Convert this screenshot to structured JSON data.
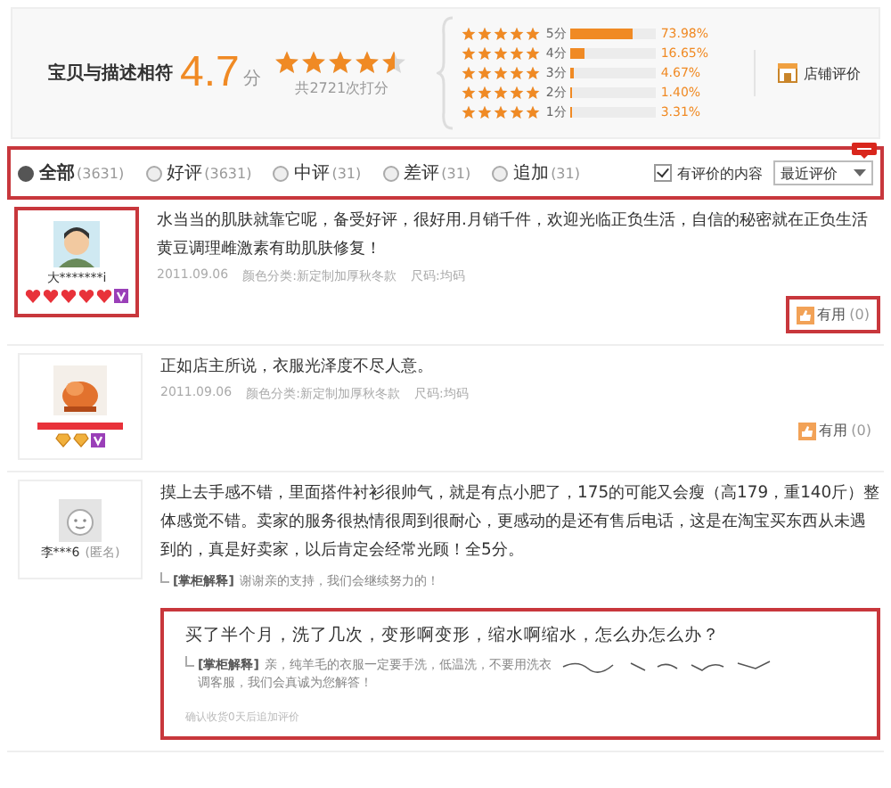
{
  "summary": {
    "label": "宝贝与描述相符",
    "score": "4.7",
    "unit": "分",
    "stars": 4.5,
    "count": "共2721次打分",
    "distribution": [
      {
        "stars": 5,
        "label": "5分",
        "level": 0.7398,
        "percent": "73.98%"
      },
      {
        "stars": 5,
        "label": "4分",
        "level": 0.1665,
        "percent": "16.65%"
      },
      {
        "stars": 5,
        "label": "3分",
        "level": 0.0467,
        "percent": "4.67%"
      },
      {
        "stars": 5,
        "label": "2分",
        "level": 0.014,
        "percent": "1.40%"
      },
      {
        "stars": 5,
        "label": "1分",
        "level": 0.0331,
        "percent": "3.31%"
      }
    ],
    "store_link": "店铺评价"
  },
  "filter": {
    "highlighted": true,
    "options": [
      {
        "label": "全部",
        "count": "(3631)",
        "selected": true
      },
      {
        "label": "好评",
        "count": "(3631)",
        "selected": false
      },
      {
        "label": "中评",
        "count": "(31)",
        "selected": false
      },
      {
        "label": "差评",
        "count": "(31)",
        "selected": false
      },
      {
        "label": "追加",
        "count": "(31)",
        "selected": false
      }
    ],
    "content_only": {
      "label": "有评价的内容",
      "checked": true
    },
    "sort": {
      "value": "最近评价"
    }
  },
  "reviews": [
    {
      "avatar": {
        "kind": "cartoon"
      },
      "highlighted": true,
      "name": "大*******i",
      "badges": [
        {
          "kind": "heart"
        },
        {
          "kind": "heart"
        },
        {
          "kind": "heart"
        },
        {
          "kind": "heart"
        },
        {
          "kind": "heart"
        },
        {
          "kind": "vip"
        }
      ],
      "text": "水当当的肌肤就靠它呢，备受好评，很好用.月销千件，欢迎光临正负生活，自信的秘密就在正负生活黄豆调理雌激素有助肌肤修复！",
      "date": "2011.09.06",
      "variant": "颜色分类:新定制加厚秋冬款",
      "size": "尺码:均码",
      "helpful": {
        "label": "有用",
        "count": "(0)",
        "highlighted": true
      }
    },
    {
      "highlighted": false,
      "name_redacted": true,
      "badges": [
        {
          "kind": "diamond"
        },
        {
          "kind": "diamond"
        },
        {
          "kind": "vip"
        }
      ],
      "text": "正如店主所说，衣服光泽度不尽人意。",
      "date": "2011.09.06",
      "variant": "颜色分类:新定制加厚秋冬款",
      "size": "尺码:均码",
      "helpful": {
        "label": "有用",
        "count": "(0)",
        "highlighted": false
      }
    },
    {
      "avatar": {
        "kind": "default"
      },
      "highlighted": false,
      "name": "李***6",
      "tag": "(匿名)",
      "text": "摸上去手感不错，里面搭件衬衫很帅气，就是有点小肥了，175的可能又会瘦（高179，重140斤）整体感觉不错。卖家的服务很热情很周到很耐心，更感动的是还有售后电话，这是在淘宝买东西从未遇到的，真是好卖家，以后肯定会经常光顾！全5分。",
      "reply": {
        "label": "[掌柜解释]",
        "text": "谢谢亲的支持，我们会继续努力的！"
      },
      "followup": {
        "highlighted": true,
        "text": "买了半个月，洗了几次，变形啊变形，缩水啊缩水，怎么办怎么办？",
        "reply": {
          "label": "[掌柜解释]",
          "text": "亲，纯羊毛的衣服一定要手洗，低温洗，不要用洗衣",
          "text_2": "调客服，我们会真诚为您解答！"
        },
        "note": "确认收货0天后追加评价"
      }
    }
  ]
}
